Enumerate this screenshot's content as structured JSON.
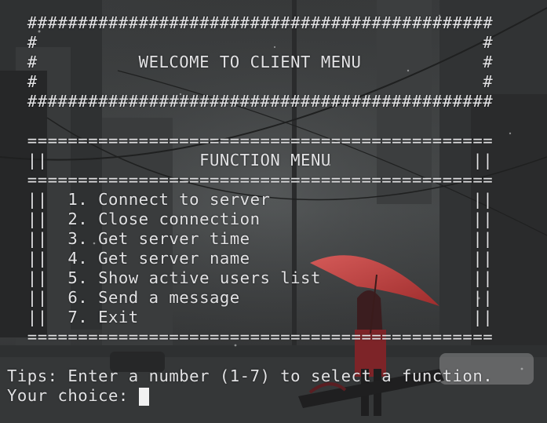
{
  "terminal": {
    "lines": [
      "  ##############################################",
      "  #                                            #",
      "  #          WELCOME TO CLIENT MENU            #",
      "  #                                            #",
      "  ##############################################",
      "",
      "  ==============================================",
      "  ||               FUNCTION MENU              ||",
      "  ==============================================",
      "  ||  1. Connect to server                    ||",
      "  ||  2. Close connection                     ||",
      "  ||  3. Get server time                      ||",
      "  ||  4. Get server name                      ||",
      "  ||  5. Show active users list               ||",
      "  ||  6. Send a message                       ||",
      "  ||  7. Exit                                 ||",
      "  ==============================================",
      "",
      "Tips: Enter a number (1-7) to select a function.",
      "Your choice: "
    ]
  },
  "colors": {
    "text": "#e2e2e4",
    "cursor": "#f1f1f1",
    "umbrella": "#c9403f"
  }
}
